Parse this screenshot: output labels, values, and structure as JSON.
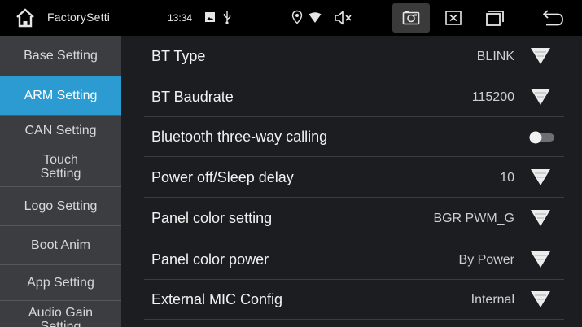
{
  "status_bar": {
    "title": "FactorySetti",
    "time": "13:34",
    "icons": [
      "home-icon",
      "gallery-icon",
      "usb-icon",
      "location-icon",
      "wifi-icon",
      "volume-mute-icon",
      "camera-icon",
      "close-box-icon",
      "recent-apps-icon",
      "back-icon"
    ]
  },
  "sidebar": {
    "items": [
      {
        "label": "Base Setting",
        "active": false
      },
      {
        "label": "ARM Setting",
        "active": true
      },
      {
        "label": "CAN Setting",
        "active": false
      },
      {
        "label": "Touch Setting",
        "active": false
      },
      {
        "label": "Logo Setting",
        "active": false
      },
      {
        "label": "Boot Anim",
        "active": false
      },
      {
        "label": "App Setting",
        "active": false
      },
      {
        "label": "Audio Gain Setting",
        "active": false
      }
    ]
  },
  "settings": {
    "rows": [
      {
        "label": "BT Type",
        "value": "BLINK",
        "control": "dropdown"
      },
      {
        "label": "BT Baudrate",
        "value": "115200",
        "control": "dropdown"
      },
      {
        "label": "Bluetooth three-way calling",
        "value": "",
        "control": "toggle",
        "toggle_on": false
      },
      {
        "label": "Power off/Sleep delay",
        "value": "10",
        "control": "dropdown"
      },
      {
        "label": "Panel color setting",
        "value": "BGR PWM_G",
        "control": "dropdown"
      },
      {
        "label": "Panel color power",
        "value": "By Power",
        "control": "dropdown"
      },
      {
        "label": "External MIC Config",
        "value": "Internal",
        "control": "dropdown"
      }
    ]
  },
  "colors": {
    "accent": "#2b9bd1",
    "sidebar_bg": "#3b3d41",
    "content_bg": "#1b1d21",
    "status_bg": "#000000"
  }
}
